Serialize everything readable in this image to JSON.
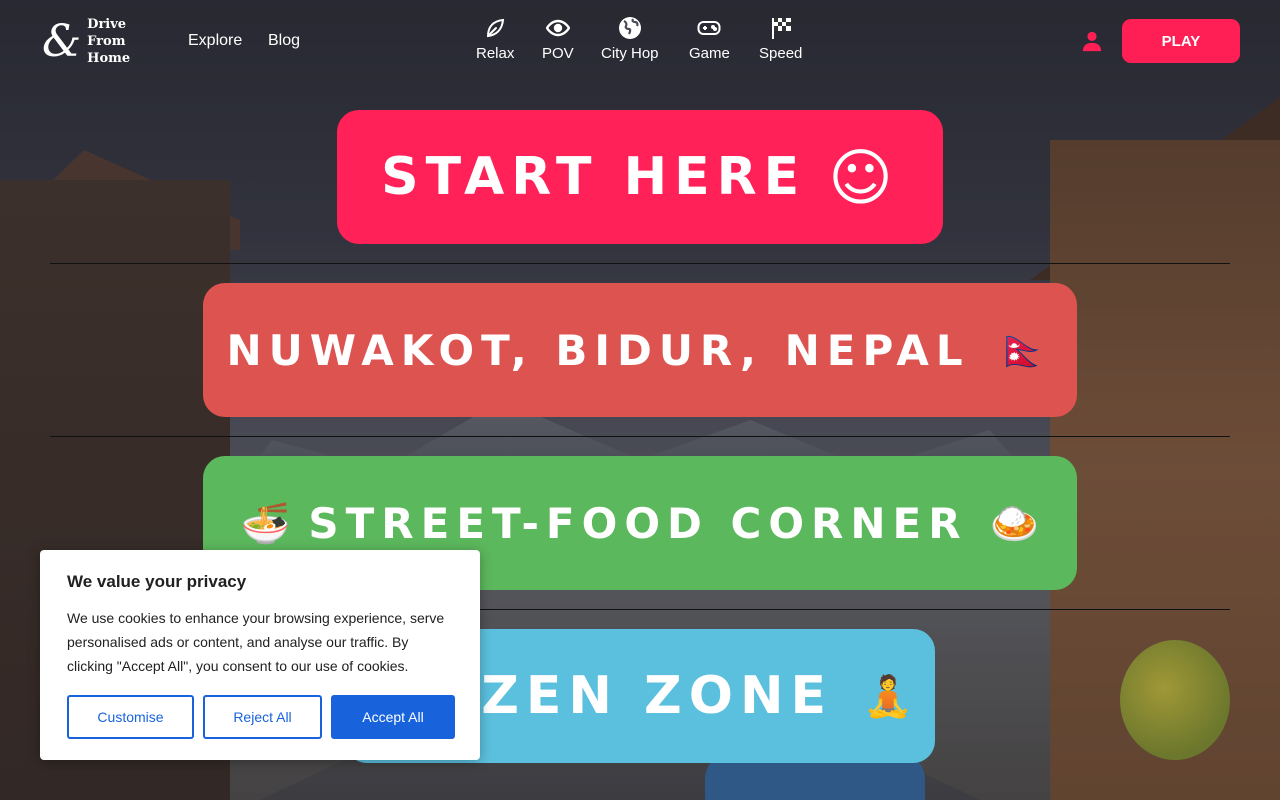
{
  "brand": {
    "amp": "&",
    "line1": "Drive",
    "line2": "From",
    "line3": "Home"
  },
  "nav": {
    "explore": "Explore",
    "blog": "Blog"
  },
  "categories": [
    {
      "label": "Relax",
      "icon": "leaf-icon"
    },
    {
      "label": "POV",
      "icon": "eye-icon"
    },
    {
      "label": "City Hop",
      "icon": "globe-icon"
    },
    {
      "label": "Game",
      "icon": "gamepad-icon"
    },
    {
      "label": "Speed",
      "icon": "checkered-flag-icon"
    }
  ],
  "header": {
    "play_label": "PLAY",
    "accent": "#ff1f55"
  },
  "sections": {
    "start": {
      "label": "START HERE",
      "emoji": "☺",
      "color": "#ff2158"
    },
    "nuwakot": {
      "label": "NUWAKOT, BIDUR, NEPAL",
      "emoji": "🇳🇵",
      "color": "#dd5350"
    },
    "food": {
      "label": "STREET-FOOD CORNER",
      "emoji_left": "🍜",
      "emoji_right": "🍛",
      "color": "#5cb85c"
    },
    "zen": {
      "label": "ZEN ZONE",
      "emoji": "🧘",
      "color": "#5bc0de"
    }
  },
  "cookie": {
    "title": "We value your privacy",
    "text": "We use cookies to enhance your browsing experience, serve personalised ads or content, and analyse our traffic. By clicking \"Accept All\", you consent to our use of cookies.",
    "customise": "Customise",
    "reject": "Reject All",
    "accept": "Accept All"
  }
}
